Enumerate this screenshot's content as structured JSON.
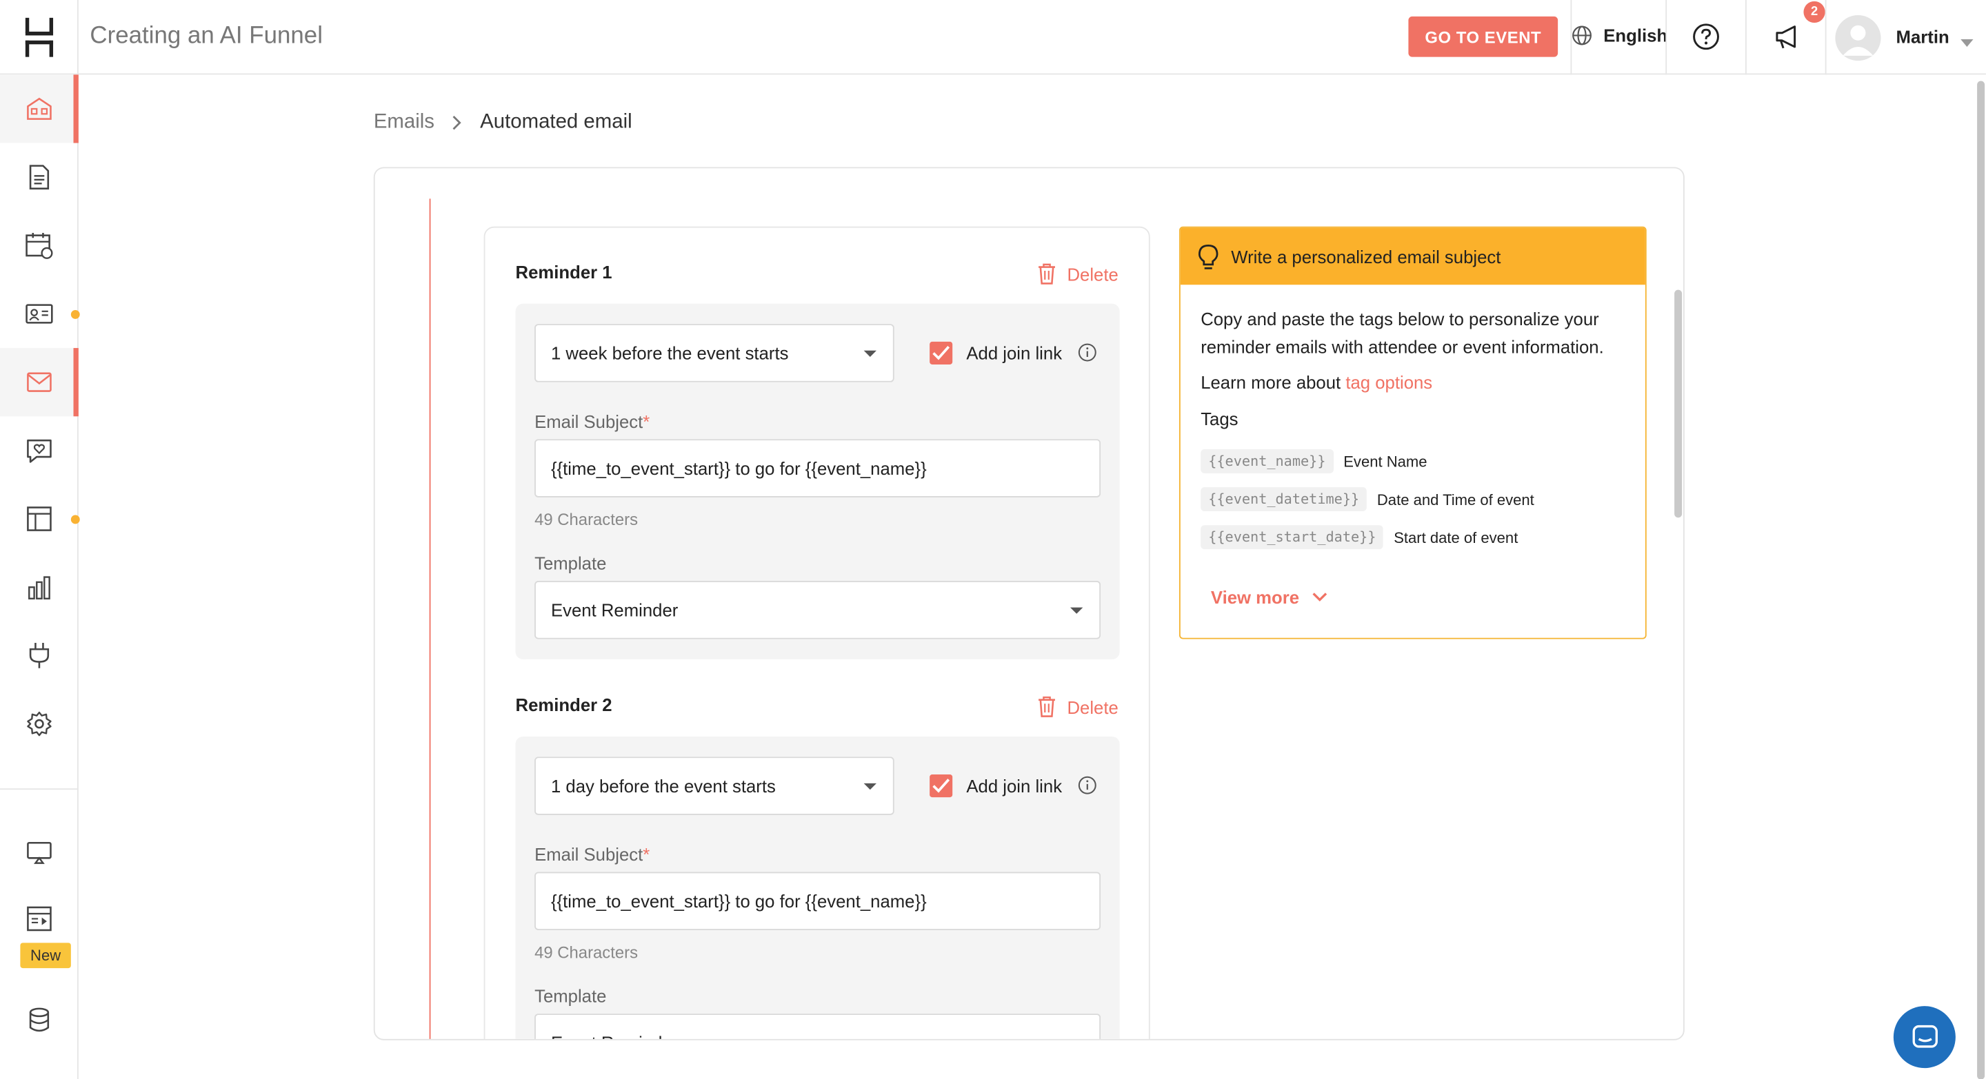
{
  "header": {
    "app_title": "Creating an AI Funnel",
    "go_to_event": "GO TO EVENT",
    "language": "English",
    "notification_count": "2",
    "user_name": "Martin"
  },
  "sidebar": {
    "items": [
      {
        "icon": "home-icon"
      },
      {
        "icon": "document-icon"
      },
      {
        "icon": "calendar-icon"
      },
      {
        "icon": "attendee-card-icon"
      },
      {
        "icon": "email-icon"
      },
      {
        "icon": "chat-heart-icon"
      },
      {
        "icon": "layout-icon"
      },
      {
        "icon": "analytics-icon"
      },
      {
        "icon": "plug-icon"
      },
      {
        "icon": "settings-icon"
      },
      {
        "icon": "presentation-icon"
      },
      {
        "icon": "video-layout-icon"
      },
      {
        "icon": "database-icon"
      }
    ],
    "new_badge": "New"
  },
  "breadcrumb": {
    "parent": "Emails",
    "current": "Automated email"
  },
  "reminders": [
    {
      "title": "Reminder 1",
      "delete_label": "Delete",
      "timing": "1 week before the event starts",
      "join_link_label": "Add join link",
      "subject_label": "Email Subject",
      "subject_value": "{{time_to_event_start}} to go for {{event_name}}",
      "char_count": "49 Characters",
      "template_label": "Template",
      "template_value": "Event Reminder"
    },
    {
      "title": "Reminder 2",
      "delete_label": "Delete",
      "timing": "1 day before the event starts",
      "join_link_label": "Add join link",
      "subject_label": "Email Subject",
      "subject_value": "{{time_to_event_start}} to go for {{event_name}}",
      "char_count": "49 Characters",
      "template_label": "Template",
      "template_value": "Event Reminder"
    }
  ],
  "tips": {
    "title": "Write a personalized email subject",
    "body": "Copy and paste the tags below to personalize your reminder emails with attendee or event information.",
    "learn_prefix": "Learn more about",
    "learn_link": "tag options",
    "tags_label": "Tags",
    "tags": [
      {
        "code": "{{event_name}}",
        "desc": "Event Name"
      },
      {
        "code": "{{event_datetime}}",
        "desc": "Date and Time of event"
      },
      {
        "code": "{{event_start_date}}",
        "desc": "Start date of event"
      }
    ],
    "view_more": "View more"
  },
  "colors": {
    "accent": "#f07264",
    "warning": "#fbb12b",
    "chat": "#1f6fbd"
  }
}
